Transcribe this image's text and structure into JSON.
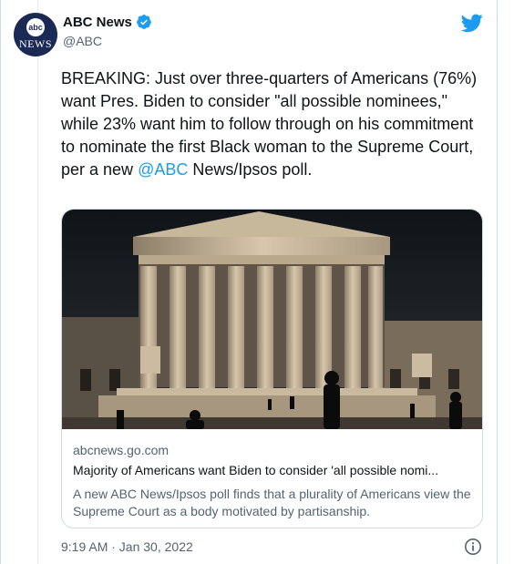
{
  "colors": {
    "link": "#1d9bf0",
    "text": "#0f1419",
    "muted": "#536471",
    "border": "#cfd9de"
  },
  "author": {
    "avatar_text_top": "abc",
    "avatar_text_bottom": "NEWS",
    "display_name": "ABC News",
    "handle": "@ABC",
    "verified_icon": "verified-badge-icon",
    "logo_icon": "twitter-bird-icon"
  },
  "tweet": {
    "text_before": "BREAKING: Just over three-quarters of Americans (76%) want Pres. Biden to consider \"all possible nominees,\" while 23% want him to follow through on his commitment to nominate the first Black woman to the Supreme Court, per a new ",
    "mention": "@ABC",
    "text_after": " News/Ipsos poll."
  },
  "card": {
    "image_subject": "supreme-court-building-photo",
    "domain": "abcnews.go.com",
    "title": "Majority of Americans want Biden to consider 'all possible nomi...",
    "description": "A new ABC News/Ipsos poll finds that a plurality of Americans view the Supreme Court as a body motivated by partisanship."
  },
  "footer": {
    "timestamp": "9:19 AM · Jan 30, 2022",
    "info_icon": "info-icon"
  }
}
